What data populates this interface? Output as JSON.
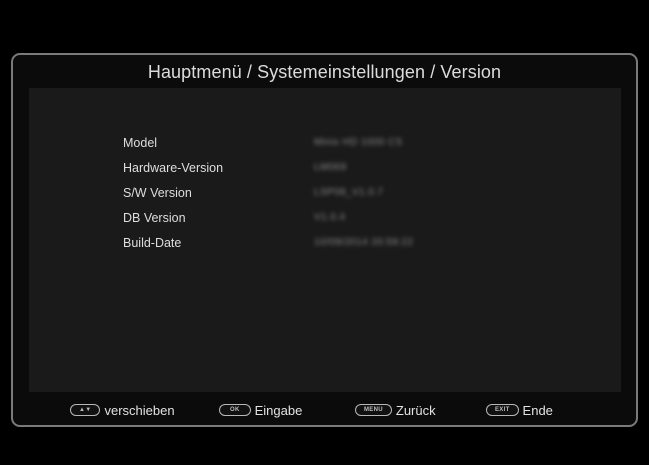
{
  "header": {
    "breadcrumb": "Hauptmenü / Systemeinstellungen / Version"
  },
  "info": {
    "rows": [
      {
        "label": "Model",
        "value": "Minix HD 1000 CS"
      },
      {
        "label": "Hardware-Version",
        "value": "LM069"
      },
      {
        "label": "S/W Version",
        "value": "LSP08_V1.0.7"
      },
      {
        "label": "DB Version",
        "value": "V1.0.4"
      },
      {
        "label": "Build-Date",
        "value": "10/09/2014 20:59:22"
      }
    ]
  },
  "footer": {
    "hints": [
      {
        "key": "▲▼",
        "label": "verschieben"
      },
      {
        "key": "OK",
        "label": "Eingabe"
      },
      {
        "key": "MENU",
        "label": "Zurück"
      },
      {
        "key": "EXIT",
        "label": "Ende"
      }
    ]
  },
  "colors": {
    "background": "#000000",
    "frame_border": "#7a7a7a",
    "panel": "#1a1a1a",
    "text": "#dedede"
  }
}
